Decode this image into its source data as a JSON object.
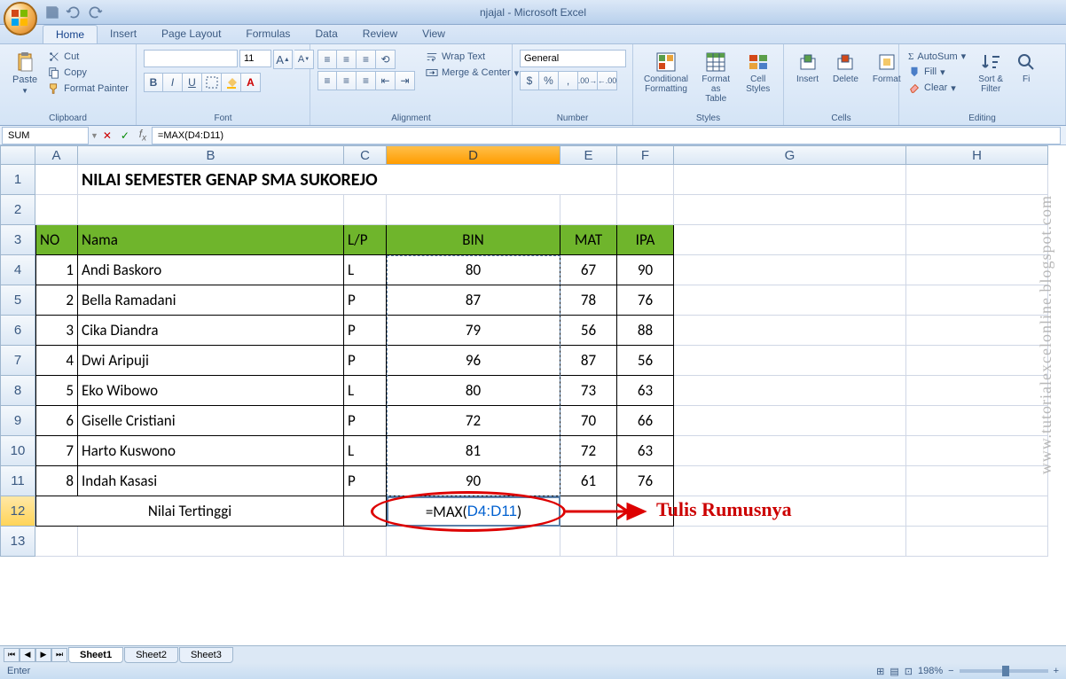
{
  "app": {
    "title": "njajal - Microsoft Excel"
  },
  "qat": {
    "save": "save",
    "undo": "undo",
    "redo": "redo"
  },
  "tabs": [
    "Home",
    "Insert",
    "Page Layout",
    "Formulas",
    "Data",
    "Review",
    "View"
  ],
  "active_tab": "Home",
  "ribbon": {
    "clipboard": {
      "label": "Clipboard",
      "paste": "Paste",
      "cut": "Cut",
      "copy": "Copy",
      "painter": "Format Painter"
    },
    "font": {
      "label": "Font",
      "name": "",
      "size": "11"
    },
    "alignment": {
      "label": "Alignment",
      "wrap": "Wrap Text",
      "merge": "Merge & Center"
    },
    "number": {
      "label": "Number",
      "format": "General"
    },
    "styles": {
      "label": "Styles",
      "cond": "Conditional Formatting",
      "table": "Format as Table",
      "cell": "Cell Styles"
    },
    "cells": {
      "label": "Cells",
      "insert": "Insert",
      "delete": "Delete",
      "format": "Format"
    },
    "editing": {
      "label": "Editing",
      "autosum": "AutoSum",
      "fill": "Fill",
      "clear": "Clear",
      "sort": "Sort & Filter",
      "find": "Fi"
    }
  },
  "formula_bar": {
    "name_box": "SUM",
    "formula": "=MAX(D4:D11)"
  },
  "columns": [
    "A",
    "B",
    "C",
    "D",
    "E",
    "F",
    "G",
    "H"
  ],
  "rows": [
    "1",
    "2",
    "3",
    "4",
    "5",
    "6",
    "7",
    "8",
    "9",
    "10",
    "11",
    "12",
    "13"
  ],
  "title_cell": "NILAI SEMESTER GENAP SMA SUKOREJO",
  "headers": {
    "no": "NO",
    "nama": "Nama",
    "lp": "L/P",
    "bin": "BIN",
    "mat": "MAT",
    "ipa": "IPA"
  },
  "data": [
    {
      "no": "1",
      "nama": "Andi Baskoro",
      "lp": "L",
      "bin": "80",
      "mat": "67",
      "ipa": "90"
    },
    {
      "no": "2",
      "nama": "Bella Ramadani",
      "lp": "P",
      "bin": "87",
      "mat": "78",
      "ipa": "76"
    },
    {
      "no": "3",
      "nama": "Cika Diandra",
      "lp": "P",
      "bin": "79",
      "mat": "56",
      "ipa": "88"
    },
    {
      "no": "4",
      "nama": "Dwi Aripuji",
      "lp": "P",
      "bin": "96",
      "mat": "87",
      "ipa": "56"
    },
    {
      "no": "5",
      "nama": "Eko Wibowo",
      "lp": "L",
      "bin": "80",
      "mat": "73",
      "ipa": "63"
    },
    {
      "no": "6",
      "nama": "Giselle Cristiani",
      "lp": "P",
      "bin": "72",
      "mat": "70",
      "ipa": "66"
    },
    {
      "no": "7",
      "nama": "Harto Kuswono",
      "lp": "L",
      "bin": "81",
      "mat": "72",
      "ipa": "63"
    },
    {
      "no": "8",
      "nama": "Indah Kasasi",
      "lp": "P",
      "bin": "90",
      "mat": "61",
      "ipa": "76"
    }
  ],
  "footer_row": {
    "label": "Nilai Tertinggi",
    "formula_display": "=MAX(D4:D11)",
    "formula_ref": "D4:D11"
  },
  "annotations": {
    "label": "Tulis Rumusnya"
  },
  "watermark": "www.tutorialexcelonline.blogspot.com",
  "sheets": [
    "Sheet1",
    "Sheet2",
    "Sheet3"
  ],
  "status": {
    "mode": "Enter",
    "zoom": "198%"
  }
}
